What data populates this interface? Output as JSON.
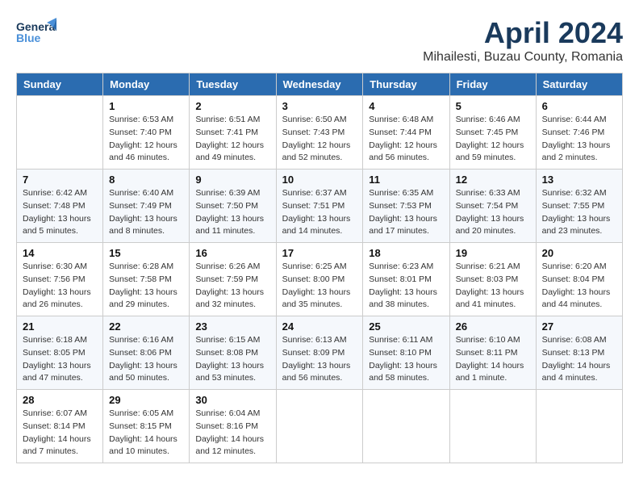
{
  "header": {
    "logo_line1": "General",
    "logo_line2": "Blue",
    "title": "April 2024",
    "subtitle": "Mihailesti, Buzau County, Romania"
  },
  "days_of_week": [
    "Sunday",
    "Monday",
    "Tuesday",
    "Wednesday",
    "Thursday",
    "Friday",
    "Saturday"
  ],
  "weeks": [
    [
      {
        "day": "",
        "sunrise": "",
        "sunset": "",
        "daylight": ""
      },
      {
        "day": "1",
        "sunrise": "Sunrise: 6:53 AM",
        "sunset": "Sunset: 7:40 PM",
        "daylight": "Daylight: 12 hours and 46 minutes."
      },
      {
        "day": "2",
        "sunrise": "Sunrise: 6:51 AM",
        "sunset": "Sunset: 7:41 PM",
        "daylight": "Daylight: 12 hours and 49 minutes."
      },
      {
        "day": "3",
        "sunrise": "Sunrise: 6:50 AM",
        "sunset": "Sunset: 7:43 PM",
        "daylight": "Daylight: 12 hours and 52 minutes."
      },
      {
        "day": "4",
        "sunrise": "Sunrise: 6:48 AM",
        "sunset": "Sunset: 7:44 PM",
        "daylight": "Daylight: 12 hours and 56 minutes."
      },
      {
        "day": "5",
        "sunrise": "Sunrise: 6:46 AM",
        "sunset": "Sunset: 7:45 PM",
        "daylight": "Daylight: 12 hours and 59 minutes."
      },
      {
        "day": "6",
        "sunrise": "Sunrise: 6:44 AM",
        "sunset": "Sunset: 7:46 PM",
        "daylight": "Daylight: 13 hours and 2 minutes."
      }
    ],
    [
      {
        "day": "7",
        "sunrise": "Sunrise: 6:42 AM",
        "sunset": "Sunset: 7:48 PM",
        "daylight": "Daylight: 13 hours and 5 minutes."
      },
      {
        "day": "8",
        "sunrise": "Sunrise: 6:40 AM",
        "sunset": "Sunset: 7:49 PM",
        "daylight": "Daylight: 13 hours and 8 minutes."
      },
      {
        "day": "9",
        "sunrise": "Sunrise: 6:39 AM",
        "sunset": "Sunset: 7:50 PM",
        "daylight": "Daylight: 13 hours and 11 minutes."
      },
      {
        "day": "10",
        "sunrise": "Sunrise: 6:37 AM",
        "sunset": "Sunset: 7:51 PM",
        "daylight": "Daylight: 13 hours and 14 minutes."
      },
      {
        "day": "11",
        "sunrise": "Sunrise: 6:35 AM",
        "sunset": "Sunset: 7:53 PM",
        "daylight": "Daylight: 13 hours and 17 minutes."
      },
      {
        "day": "12",
        "sunrise": "Sunrise: 6:33 AM",
        "sunset": "Sunset: 7:54 PM",
        "daylight": "Daylight: 13 hours and 20 minutes."
      },
      {
        "day": "13",
        "sunrise": "Sunrise: 6:32 AM",
        "sunset": "Sunset: 7:55 PM",
        "daylight": "Daylight: 13 hours and 23 minutes."
      }
    ],
    [
      {
        "day": "14",
        "sunrise": "Sunrise: 6:30 AM",
        "sunset": "Sunset: 7:56 PM",
        "daylight": "Daylight: 13 hours and 26 minutes."
      },
      {
        "day": "15",
        "sunrise": "Sunrise: 6:28 AM",
        "sunset": "Sunset: 7:58 PM",
        "daylight": "Daylight: 13 hours and 29 minutes."
      },
      {
        "day": "16",
        "sunrise": "Sunrise: 6:26 AM",
        "sunset": "Sunset: 7:59 PM",
        "daylight": "Daylight: 13 hours and 32 minutes."
      },
      {
        "day": "17",
        "sunrise": "Sunrise: 6:25 AM",
        "sunset": "Sunset: 8:00 PM",
        "daylight": "Daylight: 13 hours and 35 minutes."
      },
      {
        "day": "18",
        "sunrise": "Sunrise: 6:23 AM",
        "sunset": "Sunset: 8:01 PM",
        "daylight": "Daylight: 13 hours and 38 minutes."
      },
      {
        "day": "19",
        "sunrise": "Sunrise: 6:21 AM",
        "sunset": "Sunset: 8:03 PM",
        "daylight": "Daylight: 13 hours and 41 minutes."
      },
      {
        "day": "20",
        "sunrise": "Sunrise: 6:20 AM",
        "sunset": "Sunset: 8:04 PM",
        "daylight": "Daylight: 13 hours and 44 minutes."
      }
    ],
    [
      {
        "day": "21",
        "sunrise": "Sunrise: 6:18 AM",
        "sunset": "Sunset: 8:05 PM",
        "daylight": "Daylight: 13 hours and 47 minutes."
      },
      {
        "day": "22",
        "sunrise": "Sunrise: 6:16 AM",
        "sunset": "Sunset: 8:06 PM",
        "daylight": "Daylight: 13 hours and 50 minutes."
      },
      {
        "day": "23",
        "sunrise": "Sunrise: 6:15 AM",
        "sunset": "Sunset: 8:08 PM",
        "daylight": "Daylight: 13 hours and 53 minutes."
      },
      {
        "day": "24",
        "sunrise": "Sunrise: 6:13 AM",
        "sunset": "Sunset: 8:09 PM",
        "daylight": "Daylight: 13 hours and 56 minutes."
      },
      {
        "day": "25",
        "sunrise": "Sunrise: 6:11 AM",
        "sunset": "Sunset: 8:10 PM",
        "daylight": "Daylight: 13 hours and 58 minutes."
      },
      {
        "day": "26",
        "sunrise": "Sunrise: 6:10 AM",
        "sunset": "Sunset: 8:11 PM",
        "daylight": "Daylight: 14 hours and 1 minute."
      },
      {
        "day": "27",
        "sunrise": "Sunrise: 6:08 AM",
        "sunset": "Sunset: 8:13 PM",
        "daylight": "Daylight: 14 hours and 4 minutes."
      }
    ],
    [
      {
        "day": "28",
        "sunrise": "Sunrise: 6:07 AM",
        "sunset": "Sunset: 8:14 PM",
        "daylight": "Daylight: 14 hours and 7 minutes."
      },
      {
        "day": "29",
        "sunrise": "Sunrise: 6:05 AM",
        "sunset": "Sunset: 8:15 PM",
        "daylight": "Daylight: 14 hours and 10 minutes."
      },
      {
        "day": "30",
        "sunrise": "Sunrise: 6:04 AM",
        "sunset": "Sunset: 8:16 PM",
        "daylight": "Daylight: 14 hours and 12 minutes."
      },
      {
        "day": "",
        "sunrise": "",
        "sunset": "",
        "daylight": ""
      },
      {
        "day": "",
        "sunrise": "",
        "sunset": "",
        "daylight": ""
      },
      {
        "day": "",
        "sunrise": "",
        "sunset": "",
        "daylight": ""
      },
      {
        "day": "",
        "sunrise": "",
        "sunset": "",
        "daylight": ""
      }
    ]
  ]
}
